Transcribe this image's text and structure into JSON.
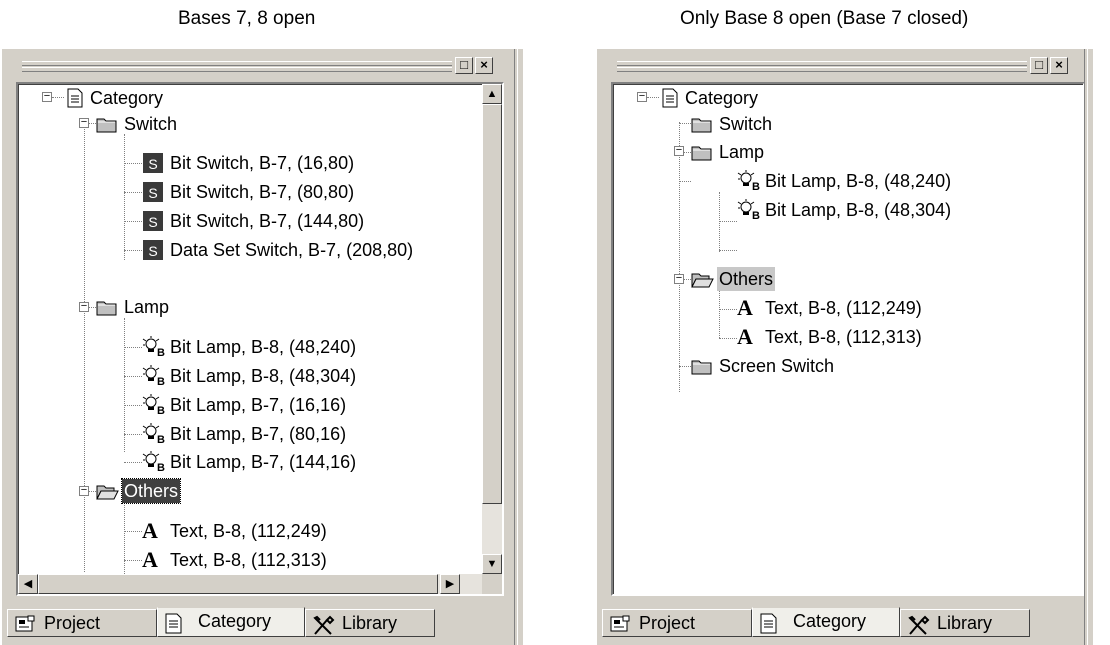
{
  "left_panel": {
    "caption": "Bases 7, 8 open",
    "window_buttons": {
      "restore": "□",
      "close": "×"
    },
    "tree": {
      "root": "Category",
      "switch_folder": "Switch",
      "switch_items": [
        "Bit Switch, B-7, (16,80)",
        "Bit Switch, B-7, (80,80)",
        "Bit Switch, B-7, (144,80)",
        "Data Set Switch, B-7, (208,80)"
      ],
      "lamp_folder": "Lamp",
      "lamp_items": [
        "Bit Lamp, B-8, (48,240)",
        "Bit Lamp, B-8, (48,304)",
        "Bit Lamp, B-7, (16,16)",
        "Bit Lamp, B-7, (80,16)",
        "Bit Lamp, B-7, (144,16)"
      ],
      "others_folder": "Others",
      "others_items": [
        "Text, B-8, (112,249)",
        "Text, B-8, (112,313)"
      ]
    },
    "tabs": [
      "Project",
      "Category",
      "Library"
    ],
    "active_tab": "Category"
  },
  "right_panel": {
    "caption": "Only Base 8 open (Base 7 closed)",
    "window_buttons": {
      "restore": "□",
      "close": "×"
    },
    "tree": {
      "root": "Category",
      "switch_folder": "Switch",
      "lamp_folder": "Lamp",
      "lamp_items": [
        "Bit Lamp, B-8, (48,240)",
        "Bit Lamp, B-8, (48,304)"
      ],
      "others_folder": "Others",
      "others_items": [
        "Text, B-8, (112,249)",
        "Text, B-8, (112,313)"
      ],
      "screen_switch_folder": "Screen Switch"
    },
    "tabs": [
      "Project",
      "Category",
      "Library"
    ],
    "active_tab": "Category"
  },
  "icons": {
    "document": "document-icon",
    "folder": "folder-icon",
    "open_folder": "open-folder-icon",
    "switch": "switch-icon",
    "lamp": "lamp-icon",
    "text": "text-icon",
    "letter_a": "A",
    "switch_glyph": "S",
    "lamp_glyph": "B"
  },
  "colors": {
    "panel": "#d4d0c8",
    "tree_bg": "#ffffff",
    "selection": "#404040"
  }
}
